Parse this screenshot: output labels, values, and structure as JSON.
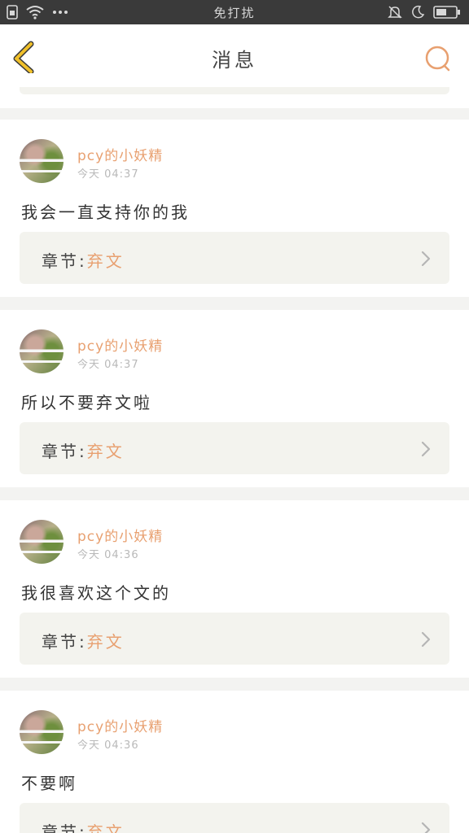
{
  "status_bar": {
    "center_text": "免打扰",
    "icons": [
      "sim-icon",
      "wifi-icon",
      "more-dots-icon",
      "bell-muted-icon",
      "moon-icon",
      "battery-icon"
    ]
  },
  "header": {
    "title": "消息",
    "back_icon": "chevron-left-icon",
    "search_icon": "search-icon"
  },
  "colors": {
    "accent": "#e8a070",
    "back_arrow": "#f0c02a",
    "text": "#333333"
  },
  "chapter_label": "章节:",
  "messages": [
    {
      "user": "pcy的小妖精",
      "time": "今天 04:37",
      "text": "我会一直支持你的我",
      "chapter": "弃文"
    },
    {
      "user": "pcy的小妖精",
      "time": "今天 04:37",
      "text": "所以不要弃文啦",
      "chapter": "弃文"
    },
    {
      "user": "pcy的小妖精",
      "time": "今天 04:36",
      "text": "我很喜欢这个文的",
      "chapter": "弃文"
    },
    {
      "user": "pcy的小妖精",
      "time": "今天 04:36",
      "text": "不要啊",
      "chapter": "弃文"
    }
  ]
}
